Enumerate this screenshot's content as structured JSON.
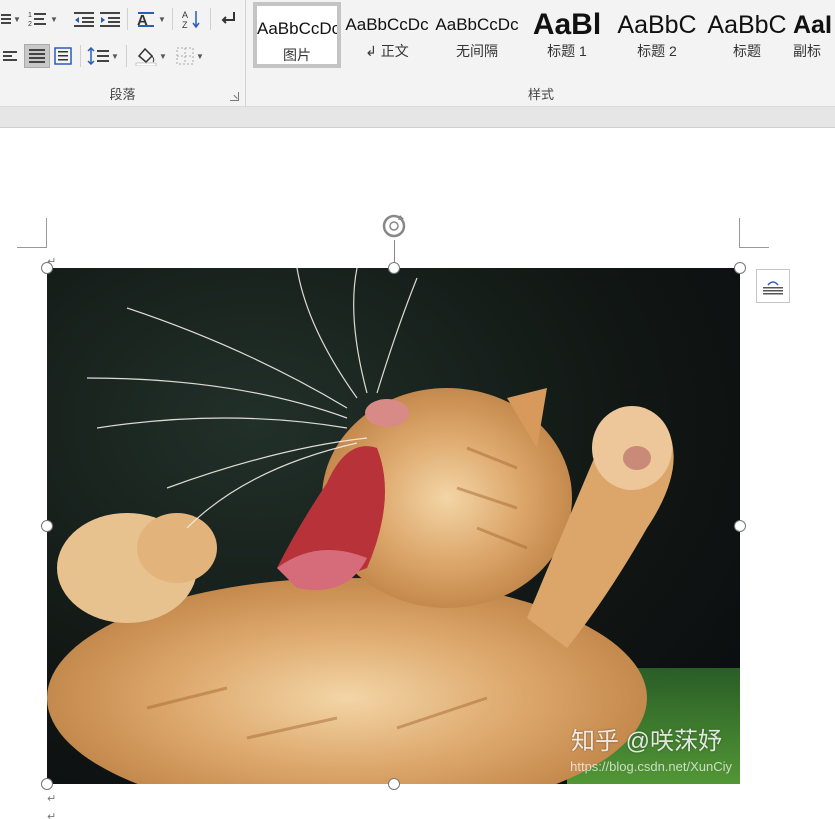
{
  "ribbon": {
    "paragraph_group_label": "段落",
    "styles_group_label": "样式",
    "styles": [
      {
        "sample": "AaBbCcDc",
        "name": "图片",
        "selected": true
      },
      {
        "sample": "AaBbCcDc",
        "name": "↲ 正文"
      },
      {
        "sample": "AaBbCcDc",
        "name": "无间隔"
      },
      {
        "sample": "AaBl",
        "name": "标题 1"
      },
      {
        "sample": "AaBbC",
        "name": "标题 2"
      },
      {
        "sample": "AaBbC",
        "name": "标题"
      },
      {
        "sample": "AaI",
        "name": "副标"
      }
    ]
  },
  "document": {
    "paragraph_mark": "↵",
    "watermark": "知乎 @咲莯妤",
    "watermark_url": "https://blog.csdn.net/XunCiy"
  },
  "icons": {
    "bullets": "bullets-icon",
    "numbering": "numbering-icon",
    "decrease_indent": "decrease-indent-icon",
    "increase_indent": "increase-indent-icon",
    "chinese_layout": "chinese-layout-icon",
    "sort": "sort-icon",
    "show_marks": "show-formatting-marks-icon",
    "align_left": "align-left-icon",
    "justify": "justify-icon",
    "distributed": "distributed-icon",
    "line_spacing": "line-spacing-icon",
    "shading": "shading-icon",
    "borders": "borders-icon",
    "rotate": "rotate-handle-icon",
    "layout_options": "layout-options-icon"
  }
}
